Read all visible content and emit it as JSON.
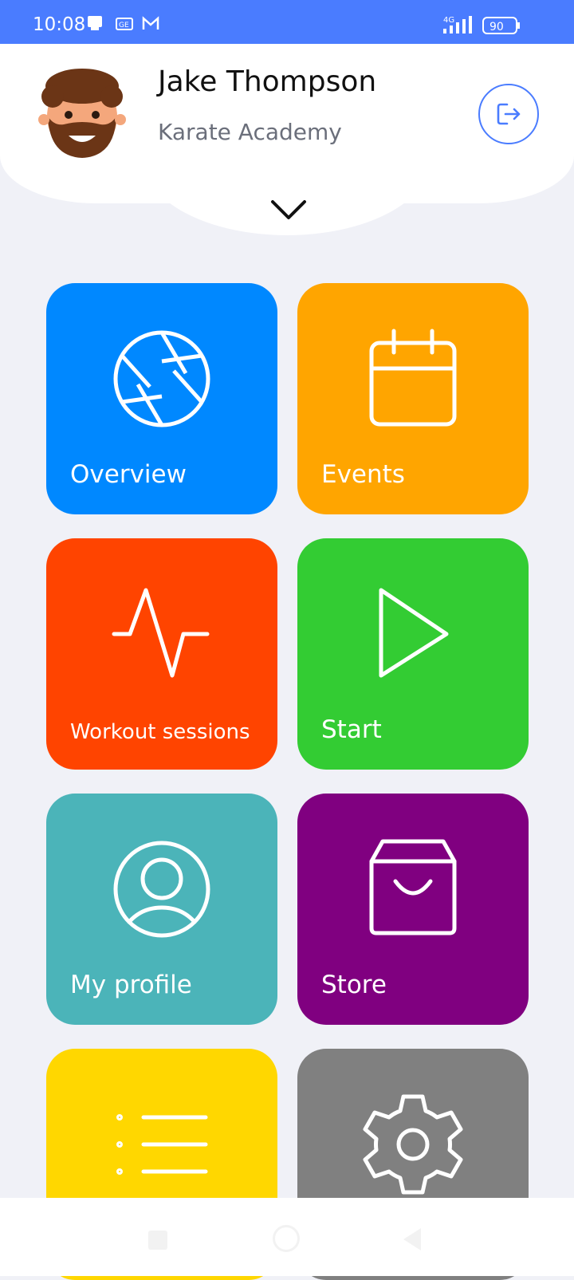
{
  "status_bar": {
    "time": "10:08",
    "network": "4G",
    "battery": "90"
  },
  "header": {
    "user_name": "Jake Thompson",
    "academy": "Karate Academy",
    "logout_icon": "logout-icon",
    "expand_icon": "chevron-down-icon"
  },
  "tiles": [
    {
      "label": "Overview",
      "color": "#0088FF",
      "icon": "aperture-icon"
    },
    {
      "label": "Events",
      "color": "#FFA500",
      "icon": "calendar-icon"
    },
    {
      "label": "Workout sessions",
      "color": "#FF4400",
      "icon": "activity-icon"
    },
    {
      "label": "Start",
      "color": "#33CC33",
      "icon": "play-icon"
    },
    {
      "label": "My profile",
      "color": "#4BB4B9",
      "icon": "user-circle-icon"
    },
    {
      "label": "Store",
      "color": "#800080",
      "icon": "shopping-bag-icon"
    },
    {
      "label": "",
      "color": "#FFD700",
      "icon": "list-icon"
    },
    {
      "label": "",
      "color": "#808080",
      "icon": "gear-icon"
    }
  ]
}
